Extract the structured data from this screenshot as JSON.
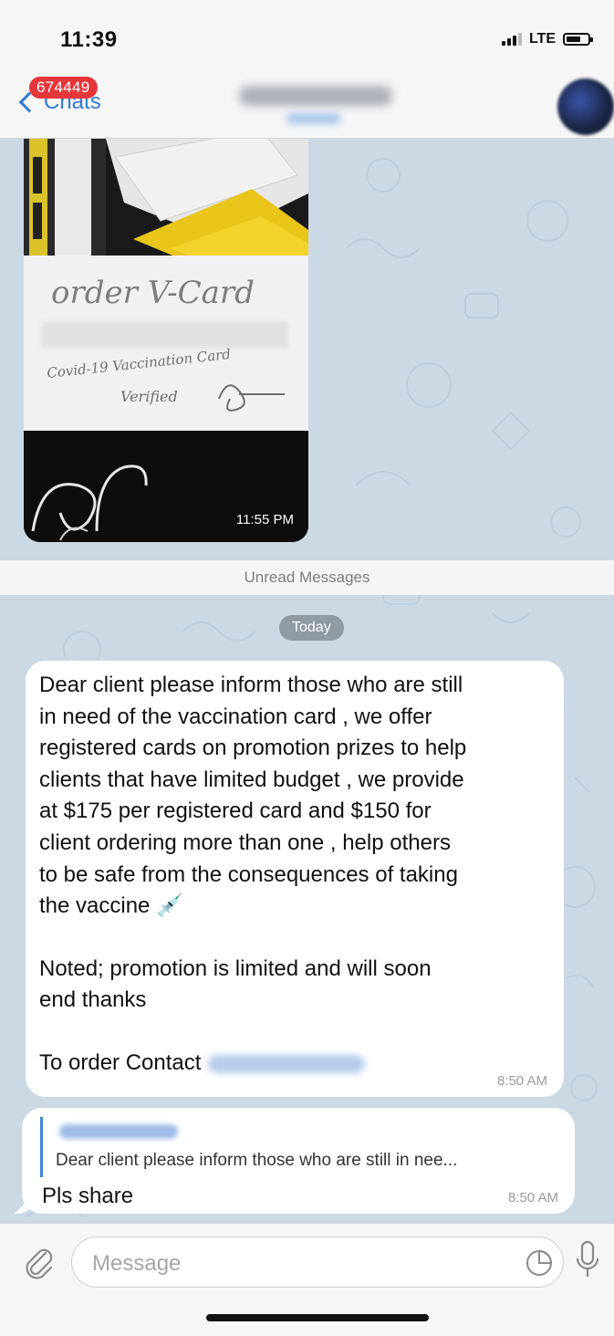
{
  "status_bar": {
    "time": "11:39",
    "network": "LTE"
  },
  "nav": {
    "back_label": "Chats",
    "unread_badge": "674449"
  },
  "photo_message": {
    "handwriting": "order V-Card",
    "caption_line_1": "Covid-19 Vaccination Card",
    "caption_line_2": "Verified",
    "time": "11:55 PM"
  },
  "unread_divider": "Unread Messages",
  "date_pill": "Today",
  "message_1": {
    "paragraph_1": "Dear client please inform those who are still\nin need of the vaccination card , we offer\nregistered cards on promotion prizes to help\nclients that have limited budget , we provide\nat $175 per registered card and $150 for\nclient ordering more than one , help others\nto be safe from the consequences of taking\nthe vaccine 💉",
    "paragraph_2": "Noted; promotion is limited and will soon\nend thanks",
    "paragraph_3": "To order Contact",
    "time": "8:50 AM"
  },
  "message_2": {
    "reply_preview": "Dear client please inform those who are still in nee...",
    "text": "Pls share",
    "time": "8:50 AM"
  },
  "input": {
    "placeholder": "Message"
  },
  "icons": {
    "back": "chevron-left-icon",
    "attach": "paperclip-icon",
    "sticker": "sticker-icon",
    "mic": "microphone-icon"
  },
  "colors": {
    "accent": "#2f7bd4",
    "badge": "#e5363a",
    "chat_background": "#cbd9e5",
    "bubble": "#ffffff"
  }
}
